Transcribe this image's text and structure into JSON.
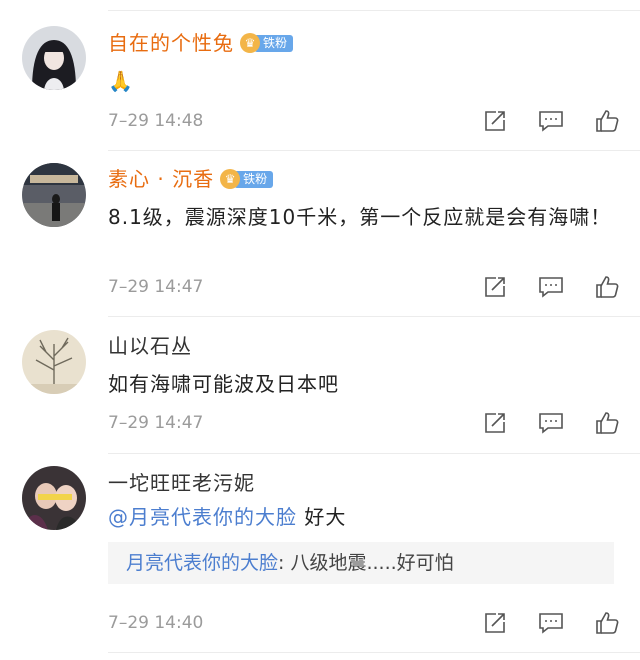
{
  "comments": [
    {
      "name": "自在的个性兔",
      "badge": "铁粉",
      "text": "🙏",
      "time": "7–29 14:48"
    },
    {
      "name": "素心 · 沉香",
      "badge": "铁粉",
      "text": "8.1级，震源深度10千米，第一个反应就是会有海啸！",
      "time": "7–29 14:47"
    },
    {
      "name": "山以石丛",
      "text": "如有海啸可能波及日本吧",
      "time": "7–29 14:47"
    },
    {
      "name": "一坨旺旺老污妮",
      "mention": "@月亮代表你的大脸",
      "text": " 好大",
      "quote_name": "月亮代表你的大脸",
      "quote_text": ": 八级地震.....好可怕",
      "time": "7–29 14:40"
    }
  ],
  "icons": {
    "forward": "forward-icon",
    "comment": "comment-icon",
    "like": "thumbs-up-icon",
    "badge": "crown-icon"
  },
  "colors": {
    "vip_name": "#e86c10",
    "link": "#4c7ecf",
    "badge_bg": "#68a7ea",
    "crown_bg": "#f3b548",
    "time": "#9b9b9b"
  }
}
